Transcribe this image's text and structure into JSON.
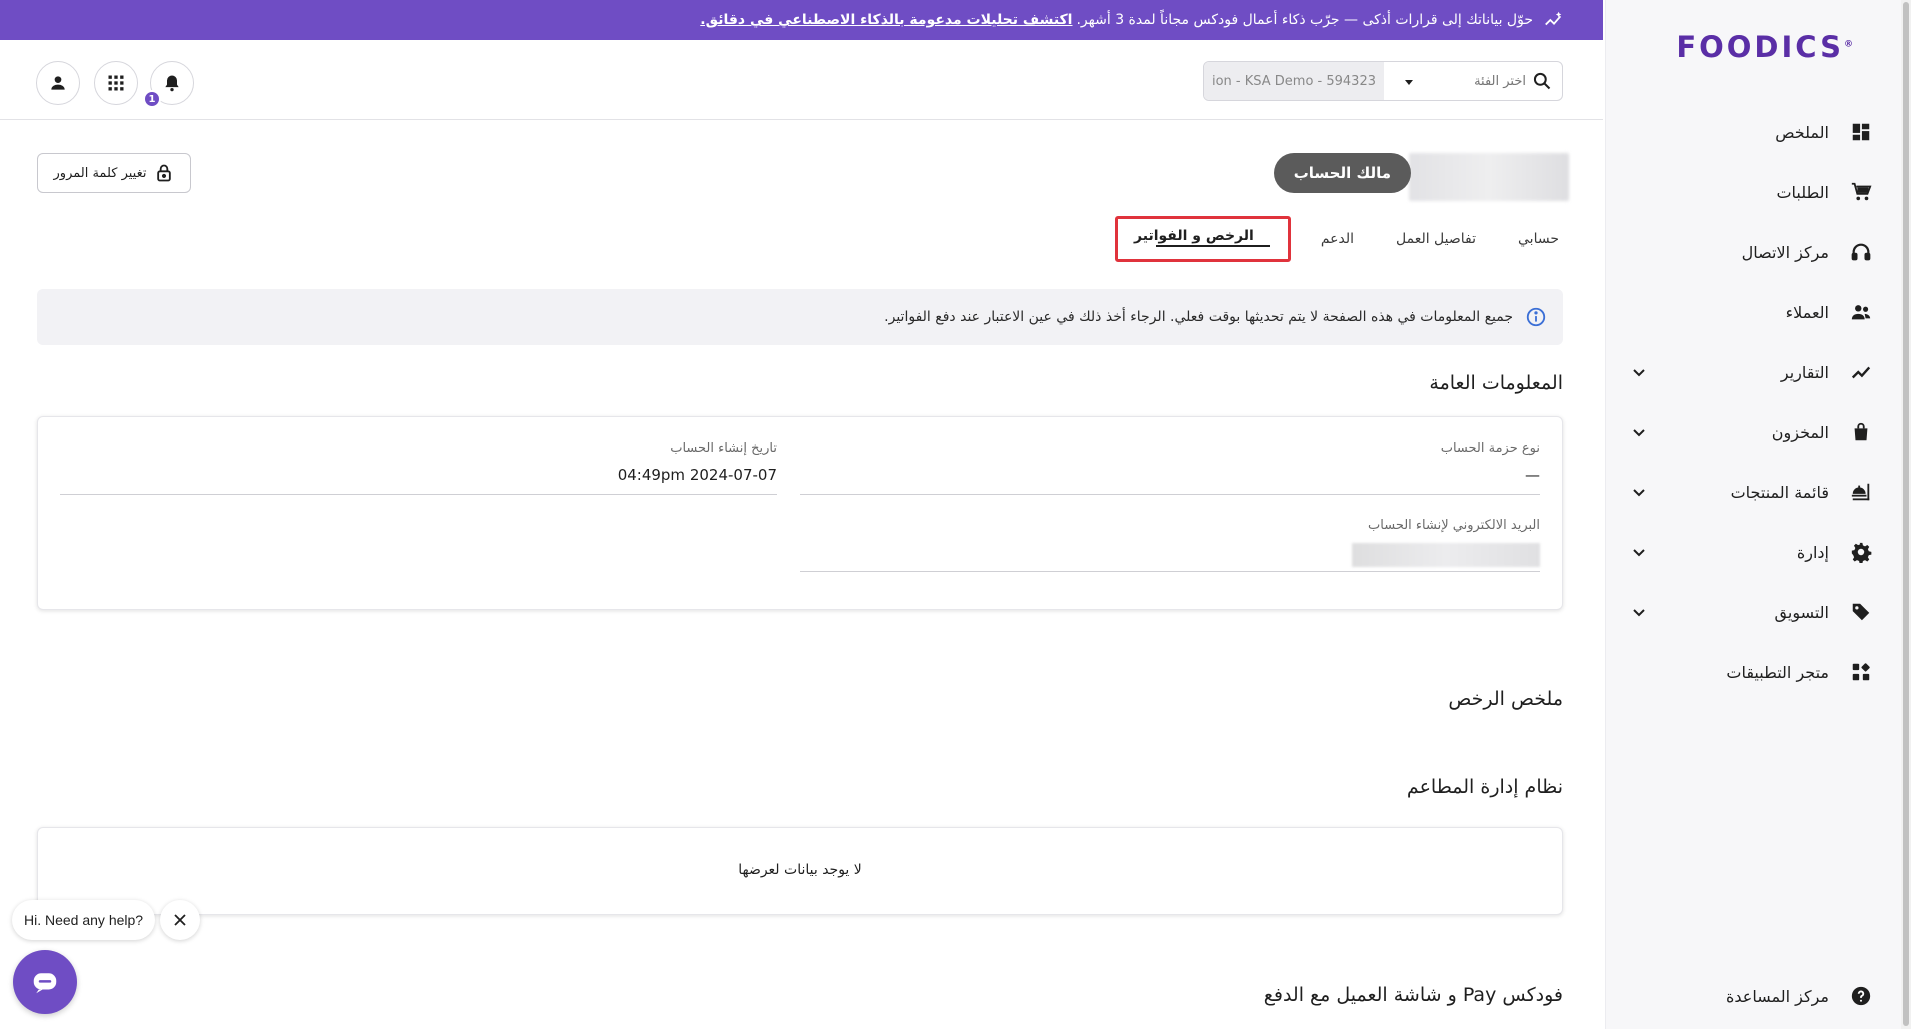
{
  "banner": {
    "text": "حوّل بياناتك إلى قرارات أذكى — جرّب ذكاء أعمال فودكس مجاناً لمدة 3 أشهر.",
    "link": "اكتشف تحليلات مدعومة بالذكاء الاصطناعي في دقائق."
  },
  "brand": {
    "logo": "FOODICS",
    "logo_mark": "®",
    "accent": "#6f4dc4"
  },
  "header": {
    "search_placeholder": "اختر الفئة",
    "branch_value": "ion - KSA Demo - 594323",
    "notification_count": "1",
    "icons": [
      "search-icon",
      "caret-down-icon",
      "bell-icon",
      "apps-grid-icon",
      "user-icon"
    ]
  },
  "sidebar": {
    "items": [
      {
        "label": "الملخص",
        "icon": "dashboard-icon"
      },
      {
        "label": "الطلبات",
        "icon": "cart-icon"
      },
      {
        "label": "مركز الاتصال",
        "icon": "headset-icon"
      },
      {
        "label": "العملاء",
        "icon": "customers-icon"
      },
      {
        "label": "التقارير",
        "icon": "chart-line-icon"
      },
      {
        "label": "المخزون",
        "icon": "bag-icon"
      },
      {
        "label": "قائمة المنتجات",
        "icon": "menu-food-icon"
      },
      {
        "label": "إدارة",
        "icon": "gear-icon"
      },
      {
        "label": "التسويق",
        "icon": "tag-icon"
      },
      {
        "label": "متجر التطبيقات",
        "icon": "apps-icon"
      }
    ],
    "help": "مركز المساعدة"
  },
  "profile": {
    "role_pill": "مالك الحساب",
    "change_password": "تغيير كلمة المرور"
  },
  "tabs": [
    "حسابي",
    "تفاصيل العمل",
    "الدعم",
    "الرخص و الفواتير"
  ],
  "alert": {
    "text": "جميع المعلومات في هذه الصفحة لا يتم تحديثها بوقت فعلي. الرجاء أخذ ذلك في عين الاعتبار عند دفع الفواتير."
  },
  "general_info": {
    "title": "المعلومات العامة",
    "package_type_label": "نوع حزمة الحساب",
    "package_type_value": "—",
    "created_at_label": "تاريخ إنشاء الحساب",
    "created_at_value": "04:49pm 2024-07-07",
    "signup_email_label": "البريد الالكتروني لإنشاء الحساب"
  },
  "licenses_summary": {
    "title": "ملخص الرخص"
  },
  "rms": {
    "title": "نظام إدارة المطاعم",
    "empty": "لا يوجد بيانات لعرضها"
  },
  "pay": {
    "title": "فودكس Pay و شاشة العميل مع الدفع"
  },
  "chat": {
    "greeting": "Hi. Need any help?"
  }
}
